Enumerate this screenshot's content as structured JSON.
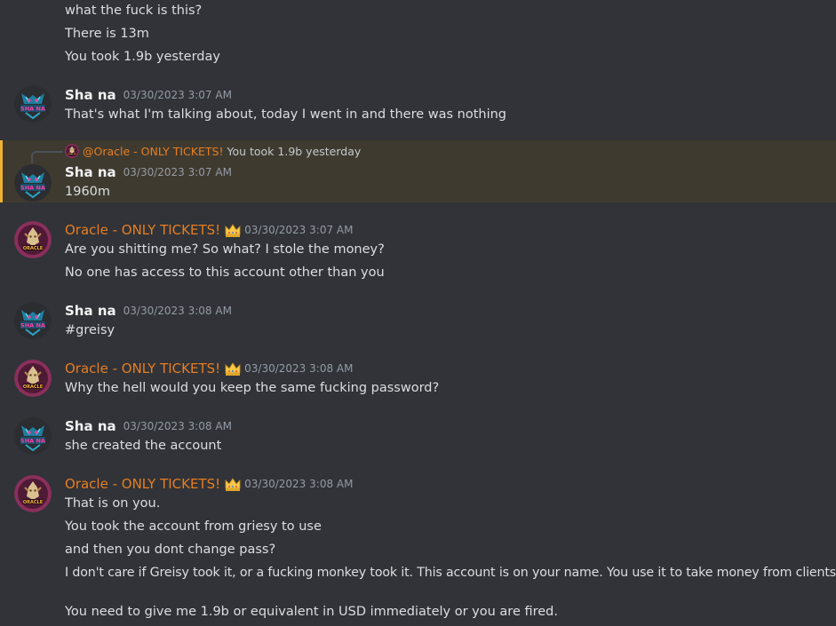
{
  "channel": {
    "messages": {
      "prev_lines": [
        "what the fuck is this?",
        "There is 13m",
        "You took 1.9b yesterday"
      ],
      "m1": {
        "author": "Sha na",
        "timestamp": "03/30/2023 3:07 AM",
        "lines": [
          "That's what I'm talking about, today I went in and there was nothing"
        ]
      },
      "m2": {
        "reply": {
          "mention": "@Oracle - ONLY TICKETS!",
          "text": "You took 1.9b yesterday"
        },
        "author": "Sha na",
        "timestamp": "03/30/2023 3:07 AM",
        "lines": [
          "1960m"
        ]
      },
      "m3": {
        "author": "Oracle - ONLY TICKETS!",
        "timestamp": "03/30/2023 3:07 AM",
        "lines": [
          "Are you shitting me? So what? I stole the money?",
          "No one has access to this account other than you"
        ]
      },
      "m4": {
        "author": "Sha na",
        "timestamp": "03/30/2023 3:08 AM",
        "lines": [
          "#greisy"
        ]
      },
      "m5": {
        "author": "Oracle - ONLY TICKETS!",
        "timestamp": "03/30/2023 3:08 AM",
        "lines": [
          "Why the hell would you keep the same fucking password?"
        ]
      },
      "m6": {
        "author": "Sha na",
        "timestamp": "03/30/2023 3:08 AM",
        "lines": [
          "she created the account"
        ]
      },
      "m7": {
        "author": "Oracle - ONLY TICKETS!",
        "timestamp": "03/30/2023 3:08 AM",
        "lines": [
          "That is on you.",
          "You took the account from griesy to use",
          "and then you dont change pass?",
          "I don't care if Greisy took it, or a fucking monkey took it. This account is on your name. You use it to take money from clients.",
          "You need to give me 1.9b or equivalent in USD immediately or you are fired."
        ]
      }
    }
  },
  "colors": {
    "background": "#313338",
    "highlight": "#3f3a30",
    "highlight_bar": "#f0b232",
    "oracle_name": "#e67e22",
    "timestamp": "#949ba4"
  },
  "icons": {
    "shana_avatar": "shana-avatar",
    "oracle_avatar": "oracle-avatar",
    "crown": "crown-icon"
  }
}
